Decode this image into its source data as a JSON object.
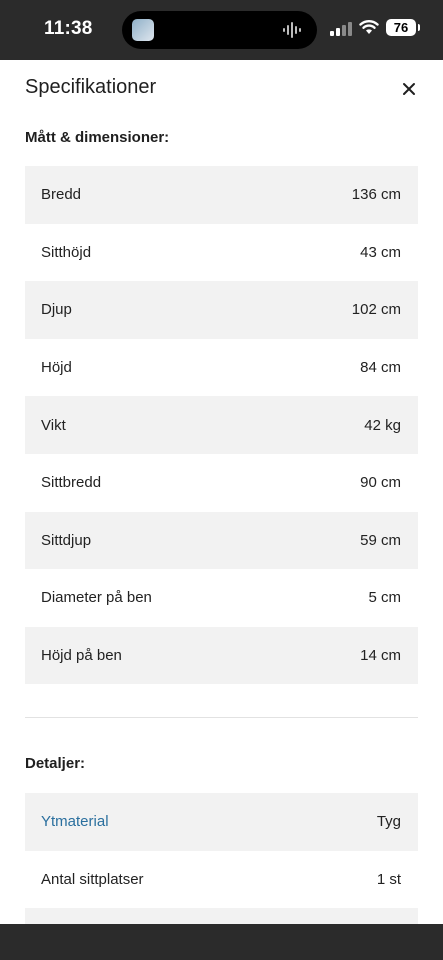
{
  "status_bar": {
    "time": "11:38",
    "battery": "76",
    "icons": [
      "signal-icon",
      "wifi-icon",
      "battery-icon",
      "audio-wave-icon"
    ]
  },
  "sheet": {
    "title": "Specifikationer",
    "close_icon": "close-icon",
    "dimensions": {
      "heading": "Mått & dimensioner:",
      "rows": [
        {
          "label": "Bredd",
          "value": "136 cm"
        },
        {
          "label": "Sitthöjd",
          "value": "43 cm"
        },
        {
          "label": "Djup",
          "value": "102 cm"
        },
        {
          "label": "Höjd",
          "value": "84 cm"
        },
        {
          "label": "Vikt",
          "value": "42 kg"
        },
        {
          "label": "Sittbredd",
          "value": "90 cm"
        },
        {
          "label": "Sittdjup",
          "value": "59 cm"
        },
        {
          "label": "Diameter på ben",
          "value": "5 cm"
        },
        {
          "label": "Höjd på ben",
          "value": "14 cm"
        }
      ]
    },
    "details": {
      "heading": "Detaljer:",
      "rows": [
        {
          "label": "Ytmaterial",
          "value": "Tyg"
        },
        {
          "label": "Antal sittplatser",
          "value": "1 st"
        }
      ]
    }
  },
  "colors": {
    "link": "#2a6f9e",
    "row_shade": "#f2f2f2",
    "chrome": "#2b2b2b"
  }
}
